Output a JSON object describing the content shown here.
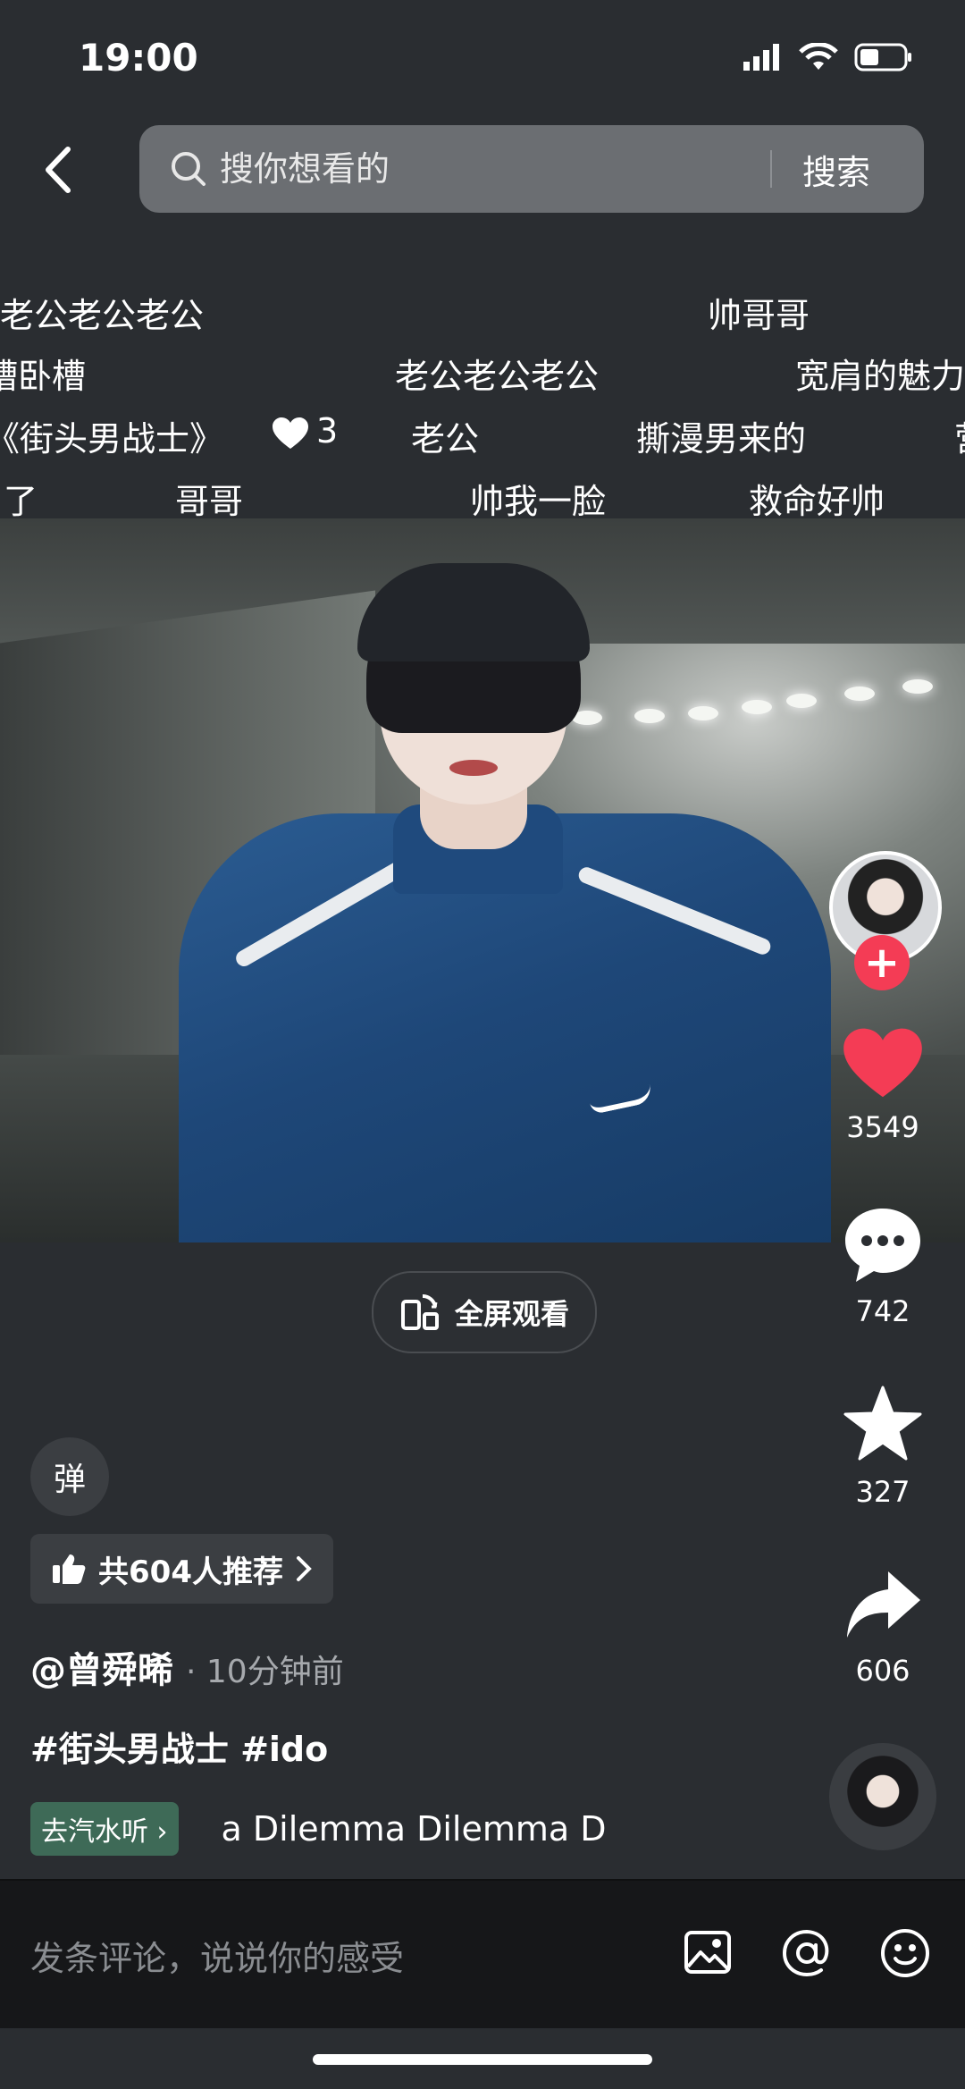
{
  "status_bar": {
    "time": "19:00"
  },
  "search": {
    "placeholder": "搜你想看的",
    "button_label": "搜索"
  },
  "danmaku": [
    {
      "text": "老公老公老公"
    },
    {
      "text": "帅哥哥"
    },
    {
      "text": "槽卧槽"
    },
    {
      "text": "老公老公老公"
    },
    {
      "text": "宽肩的魅力"
    },
    {
      "text": "《街头男战士》"
    },
    {
      "text": "3"
    },
    {
      "text": "老公"
    },
    {
      "text": "撕漫男来的"
    },
    {
      "text": "营"
    },
    {
      "text": "了"
    },
    {
      "text": "哥哥"
    },
    {
      "text": "帅我一脸"
    },
    {
      "text": "救命好帅"
    }
  ],
  "video": {
    "fullscreen_label": "全屏观看"
  },
  "actions": {
    "likes": "3549",
    "comments": "742",
    "favorites": "327",
    "shares": "606"
  },
  "info": {
    "danmu_toggle": "弹",
    "recommend": "共604人推荐",
    "author": "@曾舜晞",
    "post_time": "· 10分钟前",
    "hashtags": "#街头男战士 #ido",
    "music_tag": "去汽水听",
    "music_title": "a  Dilemma  Dilemma  D"
  },
  "comment_bar": {
    "placeholder": "发条评论，说说你的感受"
  },
  "colors": {
    "accent": "#f43c55",
    "background": "#2a2d31"
  }
}
